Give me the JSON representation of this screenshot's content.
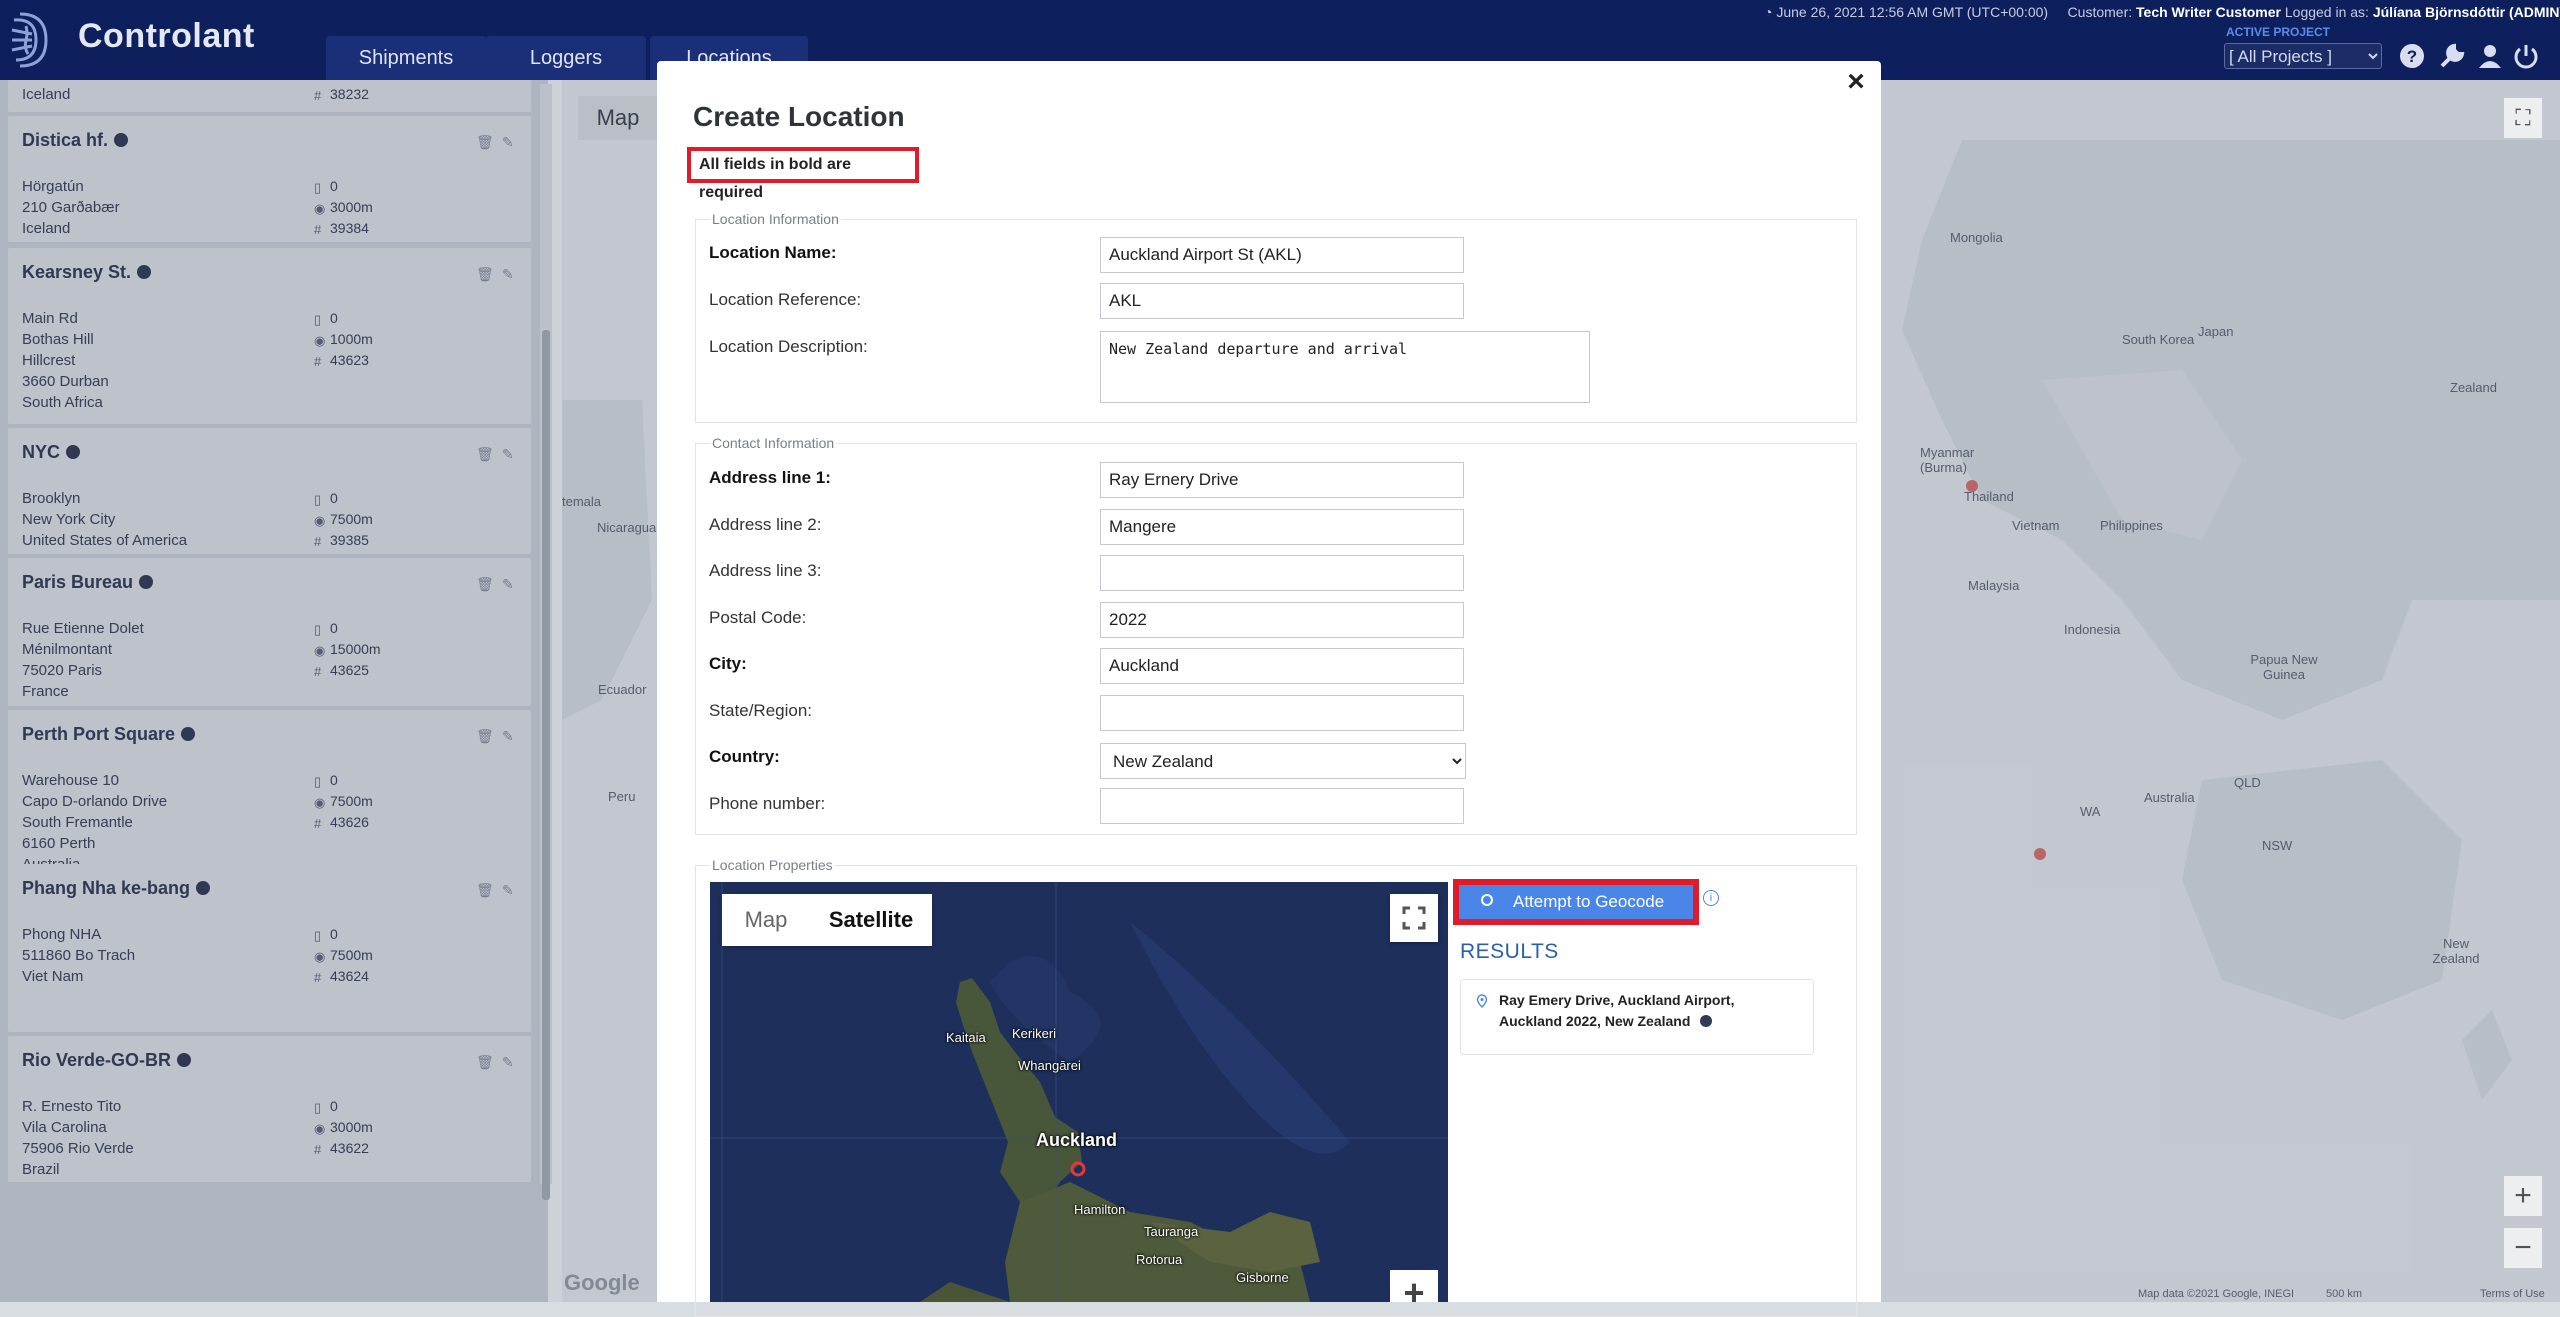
{
  "app": {
    "brand": "Controlant",
    "tabs": [
      "Shipments",
      "Loggers",
      "Locations"
    ],
    "datetime": "June 26, 2021 12:56 AM GMT (UTC+00:00)",
    "customer_label": "Customer:",
    "customer": "Tech Writer Customer",
    "logged_label": "Logged in as:",
    "user": "Júlíana Björnsdóttir (ADMIN)",
    "active_project_label": "ACTIVE PROJECT",
    "project": "[ All Projects ]",
    "accent": "#0e1f5e"
  },
  "sidebar": {
    "top_partial": {
      "addr": "Iceland",
      "id": "38232"
    },
    "cards": [
      {
        "name": "Distica hf.",
        "lines": [
          "Hörgatún",
          "210 Garðabær",
          "Iceland"
        ],
        "count": "0",
        "radius": "3000m",
        "id": "39384"
      },
      {
        "name": "Kearsney St.",
        "lines": [
          "Main Rd",
          "Bothas Hill",
          "Hillcrest",
          "3660 Durban",
          "South Africa"
        ],
        "count": "0",
        "radius": "1000m",
        "id": "43623"
      },
      {
        "name": "NYC",
        "lines": [
          "Brooklyn",
          "New York City",
          "United States of America"
        ],
        "count": "0",
        "radius": "7500m",
        "id": "39385"
      },
      {
        "name": "Paris Bureau",
        "lines": [
          "Rue Etienne Dolet",
          "Ménilmontant",
          "75020 Paris",
          "France"
        ],
        "count": "0",
        "radius": "15000m",
        "id": "43625"
      },
      {
        "name": "Perth Port Square",
        "lines": [
          "Warehouse 10",
          "Capo D-orlando Drive",
          "South Fremantle",
          "6160 Perth",
          "Australia"
        ],
        "count": "0",
        "radius": "7500m",
        "id": "43626"
      },
      {
        "name": "Phang Nha ke-bang",
        "lines": [
          "Phong NHA",
          "511860 Bo Trach",
          "Viet Nam"
        ],
        "count": "0",
        "radius": "7500m",
        "id": "43624"
      },
      {
        "name": "Rio Verde-GO-BR",
        "lines": [
          "R. Ernesto Tito",
          "Vila Carolina",
          "75906 Rio Verde",
          "Brazil"
        ],
        "count": "0",
        "radius": "3000m",
        "id": "43622"
      }
    ]
  },
  "bgmap": {
    "button": "Map",
    "labels": [
      "Mongolia",
      "South Korea",
      "Japan",
      "Myanmar (Burma)",
      "Thailand",
      "Vietnam",
      "Philippines",
      "Malaysia",
      "Indonesia",
      "Papua New Guinea",
      "Australia",
      "WA",
      "QLD",
      "NSW",
      "New Zealand",
      "temala",
      "Nicaragua",
      "Ecuador",
      "Peru",
      "Zealand"
    ],
    "google": "Google",
    "attribution": "Map data ©2021 Google, INEGI",
    "scale": "500 km",
    "terms": "Terms of Use"
  },
  "modal": {
    "title": "Create Location",
    "close": "×",
    "required_note": "All fields in bold are required",
    "location_info": {
      "legend": "Location Information",
      "name_label": "Location Name:",
      "name_value": "Auckland Airport St (AKL)",
      "ref_label": "Location Reference:",
      "ref_value": "AKL",
      "desc_label": "Location Description:",
      "desc_value": "New Zealand departure and arrival"
    },
    "contact_info": {
      "legend": "Contact Information",
      "addr1_label": "Address line 1:",
      "addr1_value": "Ray Ernery Drive",
      "addr2_label": "Address line 2:",
      "addr2_value": "Mangere",
      "addr3_label": "Address line 3:",
      "addr3_value": "",
      "postal_label": "Postal Code:",
      "postal_value": "2022",
      "city_label": "City:",
      "city_value": "Auckland",
      "state_label": "State/Region:",
      "state_value": "",
      "country_label": "Country:",
      "country_value": "New Zealand",
      "phone_label": "Phone number:",
      "phone_value": ""
    },
    "properties": {
      "legend": "Location Properties",
      "map_option": "Map",
      "satellite_option": "Satellite",
      "map_labels": [
        "Kaitaia",
        "Kerikeri",
        "Whangārei",
        "Auckland",
        "Hamilton",
        "Tauranga",
        "Rotorua",
        "Gisborne"
      ],
      "geocode_button": "Attempt to Geocode",
      "results_title": "RESULTS",
      "result": "Ray Emery Drive, Auckland Airport, Auckland 2022, New Zealand"
    }
  }
}
